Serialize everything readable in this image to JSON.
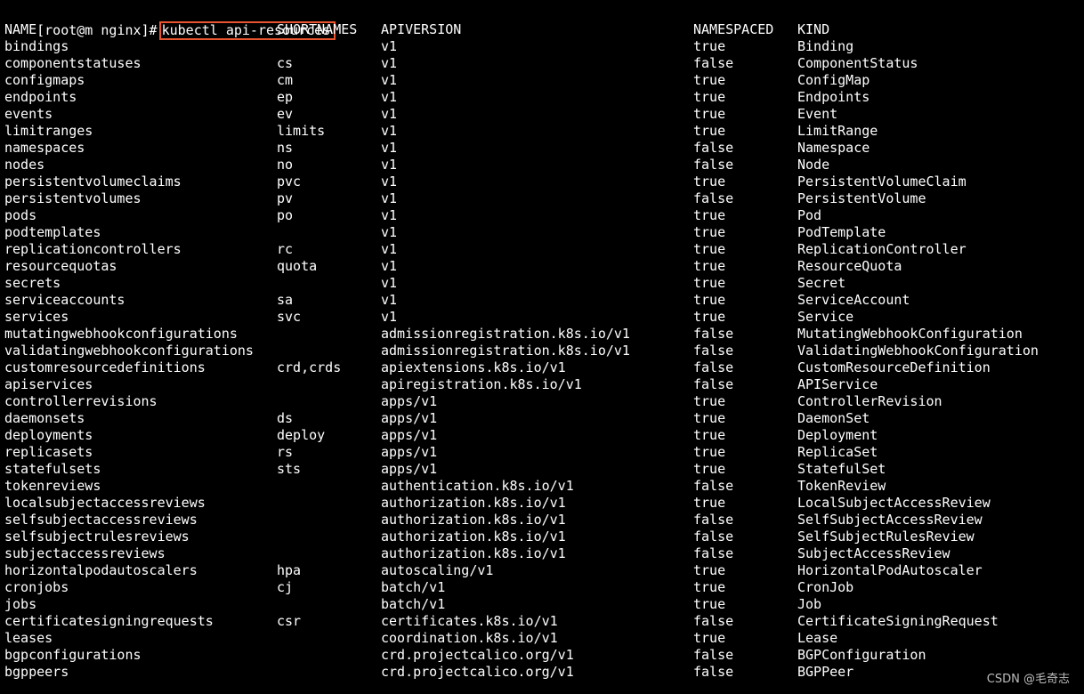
{
  "terminal": {
    "prompt": "[root@m nginx]#",
    "command": "kubectl api-resources",
    "colors": {
      "background": "#000000",
      "text": "#ffffff",
      "highlight_border": "#e8542f"
    }
  },
  "table": {
    "headers": [
      "NAME",
      "SHORTNAMES",
      "APIVERSION",
      "NAMESPACED",
      "KIND"
    ],
    "rows": [
      [
        "bindings",
        "",
        "v1",
        "true",
        "Binding"
      ],
      [
        "componentstatuses",
        "cs",
        "v1",
        "false",
        "ComponentStatus"
      ],
      [
        "configmaps",
        "cm",
        "v1",
        "true",
        "ConfigMap"
      ],
      [
        "endpoints",
        "ep",
        "v1",
        "true",
        "Endpoints"
      ],
      [
        "events",
        "ev",
        "v1",
        "true",
        "Event"
      ],
      [
        "limitranges",
        "limits",
        "v1",
        "true",
        "LimitRange"
      ],
      [
        "namespaces",
        "ns",
        "v1",
        "false",
        "Namespace"
      ],
      [
        "nodes",
        "no",
        "v1",
        "false",
        "Node"
      ],
      [
        "persistentvolumeclaims",
        "pvc",
        "v1",
        "true",
        "PersistentVolumeClaim"
      ],
      [
        "persistentvolumes",
        "pv",
        "v1",
        "false",
        "PersistentVolume"
      ],
      [
        "pods",
        "po",
        "v1",
        "true",
        "Pod"
      ],
      [
        "podtemplates",
        "",
        "v1",
        "true",
        "PodTemplate"
      ],
      [
        "replicationcontrollers",
        "rc",
        "v1",
        "true",
        "ReplicationController"
      ],
      [
        "resourcequotas",
        "quota",
        "v1",
        "true",
        "ResourceQuota"
      ],
      [
        "secrets",
        "",
        "v1",
        "true",
        "Secret"
      ],
      [
        "serviceaccounts",
        "sa",
        "v1",
        "true",
        "ServiceAccount"
      ],
      [
        "services",
        "svc",
        "v1",
        "true",
        "Service"
      ],
      [
        "mutatingwebhookconfigurations",
        "",
        "admissionregistration.k8s.io/v1",
        "false",
        "MutatingWebhookConfiguration"
      ],
      [
        "validatingwebhookconfigurations",
        "",
        "admissionregistration.k8s.io/v1",
        "false",
        "ValidatingWebhookConfiguration"
      ],
      [
        "customresourcedefinitions",
        "crd,crds",
        "apiextensions.k8s.io/v1",
        "false",
        "CustomResourceDefinition"
      ],
      [
        "apiservices",
        "",
        "apiregistration.k8s.io/v1",
        "false",
        "APIService"
      ],
      [
        "controllerrevisions",
        "",
        "apps/v1",
        "true",
        "ControllerRevision"
      ],
      [
        "daemonsets",
        "ds",
        "apps/v1",
        "true",
        "DaemonSet"
      ],
      [
        "deployments",
        "deploy",
        "apps/v1",
        "true",
        "Deployment"
      ],
      [
        "replicasets",
        "rs",
        "apps/v1",
        "true",
        "ReplicaSet"
      ],
      [
        "statefulsets",
        "sts",
        "apps/v1",
        "true",
        "StatefulSet"
      ],
      [
        "tokenreviews",
        "",
        "authentication.k8s.io/v1",
        "false",
        "TokenReview"
      ],
      [
        "localsubjectaccessreviews",
        "",
        "authorization.k8s.io/v1",
        "true",
        "LocalSubjectAccessReview"
      ],
      [
        "selfsubjectaccessreviews",
        "",
        "authorization.k8s.io/v1",
        "false",
        "SelfSubjectAccessReview"
      ],
      [
        "selfsubjectrulesreviews",
        "",
        "authorization.k8s.io/v1",
        "false",
        "SelfSubjectRulesReview"
      ],
      [
        "subjectaccessreviews",
        "",
        "authorization.k8s.io/v1",
        "false",
        "SubjectAccessReview"
      ],
      [
        "horizontalpodautoscalers",
        "hpa",
        "autoscaling/v1",
        "true",
        "HorizontalPodAutoscaler"
      ],
      [
        "cronjobs",
        "cj",
        "batch/v1",
        "true",
        "CronJob"
      ],
      [
        "jobs",
        "",
        "batch/v1",
        "true",
        "Job"
      ],
      [
        "certificatesigningrequests",
        "csr",
        "certificates.k8s.io/v1",
        "false",
        "CertificateSigningRequest"
      ],
      [
        "leases",
        "",
        "coordination.k8s.io/v1",
        "true",
        "Lease"
      ],
      [
        "bgpconfigurations",
        "",
        "crd.projectcalico.org/v1",
        "false",
        "BGPConfiguration"
      ],
      [
        "bgppeers",
        "",
        "crd.projectcalico.org/v1",
        "false",
        "BGPPeer"
      ]
    ]
  },
  "watermark": "CSDN @毛奇志"
}
